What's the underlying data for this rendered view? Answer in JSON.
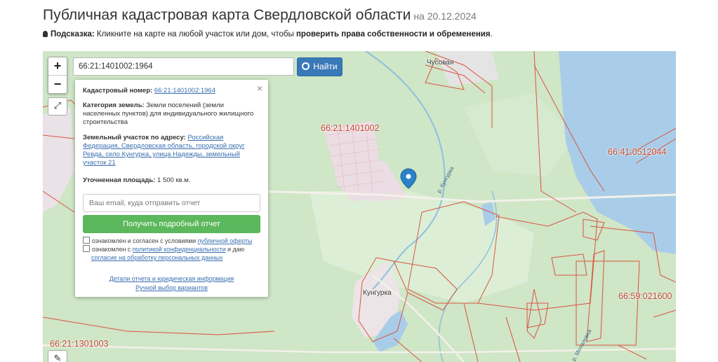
{
  "header": {
    "title": "Публичная кадастровая карта Свердловской области",
    "date": "на 20.12.2024"
  },
  "hint": {
    "label": "Подсказка:",
    "text": " Кликните на карте на любой участок или дом, чтобы ",
    "bold_text": "проверить права собственности и обременения",
    "end": "."
  },
  "search": {
    "value": "66:21:1401002:1964",
    "button_label": "Найти"
  },
  "zoom": {
    "plus": "+",
    "minus": "−"
  },
  "popup": {
    "close": "×",
    "cadastral_label": "Кадастровый номер:",
    "cadastral_value": "66:21:1401002:1964",
    "category_label": "Категория земель:",
    "category_value": " Земли поселений (земли населенных пунктов) для индивидуального жилищного строительства",
    "address_label": "Земельный участок по адресу:",
    "address_value": "Российская Федерация, Свердловская область, городской округ Ревда, село Кунгурка, улица Надежды, земельный участок 21",
    "area_label": "Уточненная площадь:",
    "area_value": " 1 500 кв.м.",
    "email_placeholder": "Ваш email, куда отправить отчет",
    "report_button": "Получить подробный отчет",
    "consent1_text": "ознакомлен и согласен с условиями ",
    "consent1_link": "публичной оферты",
    "consent2_text": "ознакомлен с ",
    "consent2_link": "политикой конфиденциальности",
    "consent2_mid": " и даю",
    "consent2_link2": "согласие на обработку персональных данных",
    "details_link": "Детали отчета и юридическая информация",
    "manual_link": "Ручной выбор вариантов"
  },
  "map_labels": {
    "chusovaya": "Чусовая",
    "kungurka": "Кунгурка",
    "river_kungurka": "р. Кунгурка",
    "river_mochalovka": "р. Мочаловка",
    "cad_1401002": "66:21:1401002",
    "cad_41": "66:41:0512044",
    "cad_59": "66:59:021600",
    "cad_1301003": "66:21:1301003"
  },
  "colors": {
    "forest": "#cfe6c7",
    "lake": "#a9cde9",
    "boundary": "#d9553f",
    "marker": "#2a82c9",
    "button_blue": "#3a79b8",
    "button_green": "#5cb85c"
  }
}
